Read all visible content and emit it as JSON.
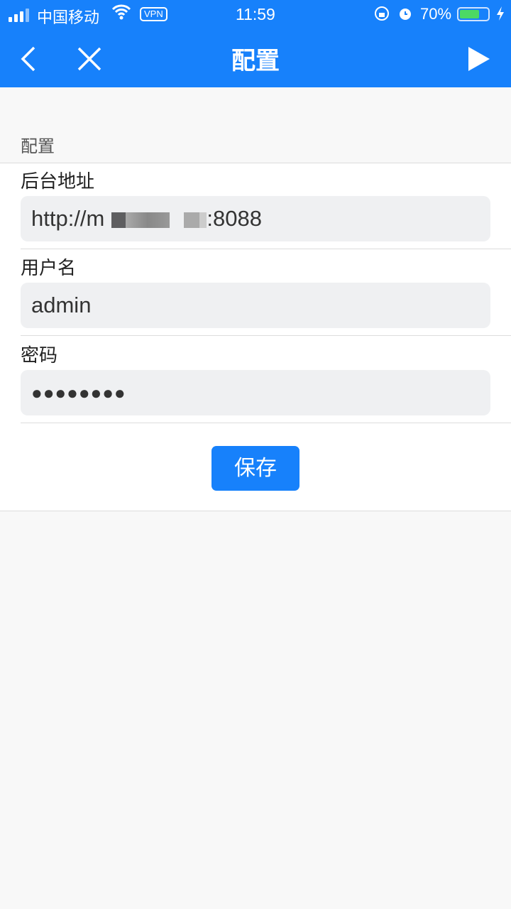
{
  "status_bar": {
    "carrier": "中国移动",
    "vpn": "VPN",
    "time": "11:59",
    "battery": "70%",
    "battery_level": 0.7
  },
  "nav": {
    "title": "配置",
    "back_icon": "chevron-left-icon",
    "close_icon": "close-icon",
    "run_icon": "play-icon"
  },
  "section": {
    "label": "配置"
  },
  "form": {
    "backend": {
      "label": "后台地址",
      "value_prefix": "http://m",
      "value_suffix": ":8088"
    },
    "username": {
      "label": "用户名",
      "value": "admin"
    },
    "password": {
      "label": "密码",
      "value": "●●●●●●●●"
    },
    "save_label": "保存"
  },
  "colors": {
    "accent": "#1781fb",
    "battery": "#4cd964"
  }
}
